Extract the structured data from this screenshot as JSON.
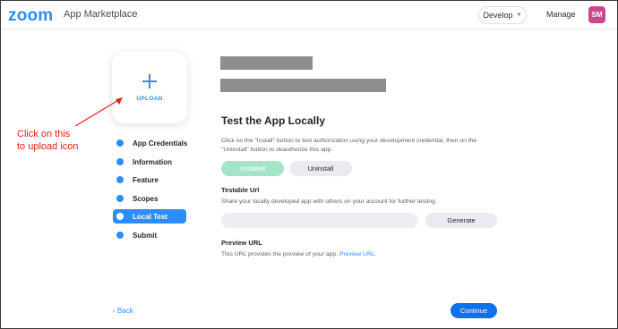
{
  "header": {
    "logo": "zoom",
    "app_title": "App Marketplace",
    "develop_label": "Develop",
    "manage_label": "Manage",
    "avatar_initials": "SM",
    "avatar_color": "#c74a8f"
  },
  "upload": {
    "label": "UPLOAD",
    "icon": "plus-icon"
  },
  "annotation": {
    "line1": "Click on this",
    "line2": "to upload icon",
    "color": "#e0201b"
  },
  "steps": [
    {
      "label": "App Credentials",
      "active": false
    },
    {
      "label": "Information",
      "active": false
    },
    {
      "label": "Feature",
      "active": false
    },
    {
      "label": "Scopes",
      "active": false
    },
    {
      "label": "Local Test",
      "active": true
    },
    {
      "label": "Submit",
      "active": false
    }
  ],
  "main": {
    "title": "Test the App Locally",
    "description": "Click on the \"Install\" button to test authorization using your development credential, then on the \"Uninstall\" button to deauthorize this app.",
    "installed_label": "Installed",
    "uninstall_label": "Uninstall",
    "testable_url_title": "Testable Url",
    "testable_url_desc": "Share your locally developed app with others on your account for further testing.",
    "testable_url_value": "",
    "generate_label": "Generate",
    "preview_title": "Preview URL",
    "preview_desc": "This URL provides the preview of your app.",
    "preview_link": "Preview URL."
  },
  "footer": {
    "back_label": "Back",
    "continue_label": "Continue"
  },
  "colors": {
    "accent": "#2d8cff",
    "installed_bg": "#a4e5c8",
    "continue_bg": "#0e72ed"
  }
}
